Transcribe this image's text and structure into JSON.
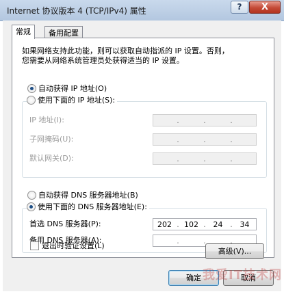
{
  "window": {
    "title": "Internet 协议版本 4 (TCP/IPv4) 属性",
    "help_label": "?",
    "close_label": "X"
  },
  "tabs": [
    {
      "label": "常规",
      "active": true
    },
    {
      "label": "备用配置",
      "active": false
    }
  ],
  "description": {
    "line1": "如果网络支持此功能，则可以获取自动指派的 IP 设置。否则，",
    "line2": "您需要从网络系统管理员处获得适当的 IP 设置。"
  },
  "ip_section": {
    "auto_label": "自动获得 IP 地址(O)",
    "manual_label": "使用下面的 IP 地址(S):",
    "selected": "auto",
    "fields": [
      {
        "label": "IP 地址(I):",
        "value": [
          "",
          "",
          "",
          ""
        ]
      },
      {
        "label": "子网掩码(U):",
        "value": [
          "",
          "",
          "",
          ""
        ]
      },
      {
        "label": "默认网关(D):",
        "value": [
          "",
          "",
          "",
          ""
        ]
      }
    ]
  },
  "dns_section": {
    "auto_label": "自动获得 DNS 服务器地址(B)",
    "manual_label": "使用下面的 DNS 服务器地址(E):",
    "selected": "manual",
    "fields": [
      {
        "label": "首选 DNS 服务器(P):",
        "value": [
          "202",
          "102",
          "24",
          "34"
        ]
      },
      {
        "label": "备用 DNS 服务器(A):",
        "value": [
          "",
          "",
          "",
          ""
        ]
      }
    ]
  },
  "validate_checkbox": {
    "label": "退出时验证设置(L)",
    "checked": false
  },
  "buttons": {
    "advanced": "高级(V)...",
    "ok": "确定",
    "cancel": "取消"
  },
  "watermark": "我爱IT技术网"
}
